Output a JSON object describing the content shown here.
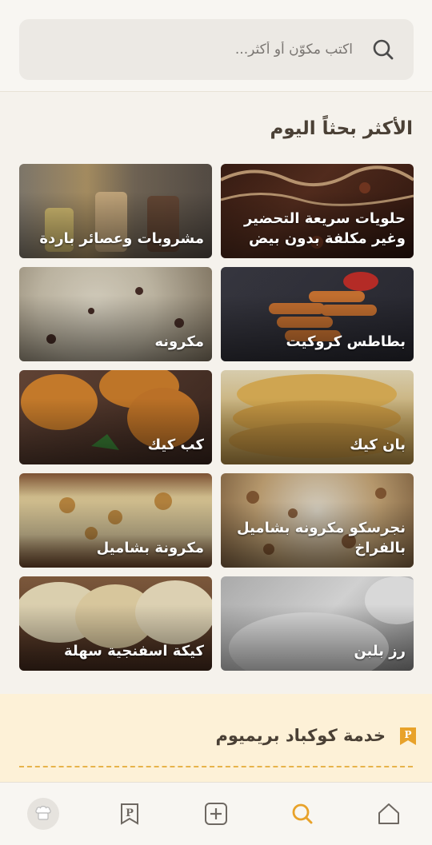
{
  "search": {
    "placeholder": "اكتب مكوّن أو أكثر..."
  },
  "section": {
    "title": "الأكثر بحثاً اليوم"
  },
  "tiles": [
    {
      "label": "حلويات سريعة التحضير وغير مكلفة بدون بيض"
    },
    {
      "label": "مشروبات وعصائر باردة"
    },
    {
      "label": "بطاطس كروكيت"
    },
    {
      "label": "مكرونه"
    },
    {
      "label": "بان كيك"
    },
    {
      "label": "كب كيك"
    },
    {
      "label": "نجرسكو مكرونه بشاميل بالفراخ"
    },
    {
      "label": "مكرونة بشاميل"
    },
    {
      "label": "رز بلبن"
    },
    {
      "label": "كيكة اسفنجية سهلة"
    }
  ],
  "premium": {
    "title": "خدمة كوكباد بريميوم",
    "icon": "premium-bookmark-icon"
  },
  "nav": {
    "items": [
      {
        "icon": "profile-avatar-icon"
      },
      {
        "icon": "premium-icon"
      },
      {
        "icon": "add-recipe-icon"
      },
      {
        "icon": "search-icon"
      },
      {
        "icon": "home-icon"
      }
    ],
    "active_color": "#e8a22a"
  },
  "colors": {
    "accent": "#e8a22a",
    "premium_bg": "#fdf1d7"
  }
}
